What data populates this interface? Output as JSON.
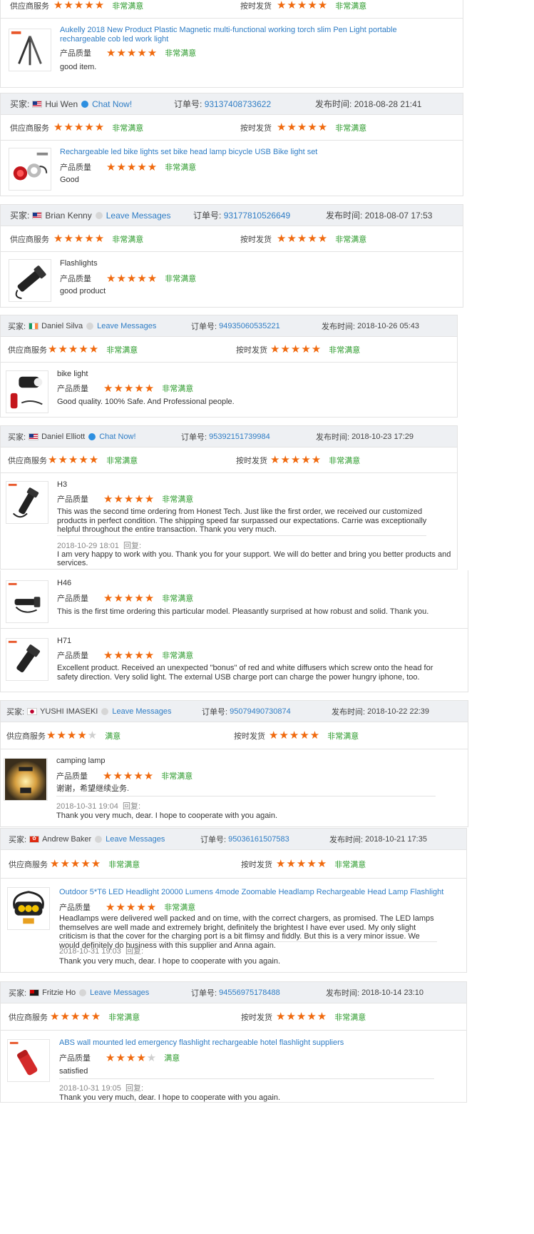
{
  "labels": {
    "supplier_service": "供应商服务",
    "on_time_delivery": "按时发货",
    "product_quality": "产品质量",
    "very_satisfied": "非常满意",
    "satisfied": "满意",
    "buyer": "买家:",
    "order_no": "订单号:",
    "published": "发布时间:",
    "reply": "回复:",
    "chat_now": "Chat Now!",
    "leave_messages": "Leave Messages"
  },
  "colors": {
    "star": "#f06a0f",
    "link": "#2f7dc5",
    "grade": "#2a9a2a",
    "header_bg": "#eef0f3"
  },
  "reviews": [
    {
      "supplier_stars": 5,
      "delivery_stars": 5,
      "product": {
        "title": "Aukelly 2018 New Product Plastic Magnetic multi-functional working torch slim Pen Light portable rechargeable cob led work light",
        "quality_stars": 5,
        "text": "good item.",
        "thumb": "pen-light-icon"
      }
    },
    {
      "buyer": "Hui Wen",
      "flag": "us-flag-icon",
      "contact": "Chat Now!",
      "order": "93137408733622",
      "time": "2018-08-28 21:41",
      "supplier_stars": 5,
      "delivery_stars": 5,
      "product": {
        "title": "Rechargeable led bike lights set bike head lamp bicycle USB Bike light set",
        "quality_stars": 5,
        "text": "Good",
        "thumb": "bike-light-icon"
      }
    },
    {
      "buyer": "Brian Kenny",
      "flag": "us-flag-icon",
      "contact": "Leave Messages",
      "order": "93177810526649",
      "time": "2018-08-07 17:53",
      "supplier_stars": 5,
      "delivery_stars": 5,
      "product": {
        "title": "Flashlights",
        "quality_stars": 5,
        "text": "good product",
        "thumb": "flashlight-icon"
      }
    },
    {
      "buyer": "Daniel Silva",
      "flag": "ireland-flag-icon",
      "contact": "Leave Messages",
      "order": "94935060535221",
      "time": "2018-10-26 05:43",
      "supplier_stars": 5,
      "delivery_stars": 5,
      "product": {
        "title": "bike light",
        "quality_stars": 5,
        "text": "Good quality. 100% Safe. And Professional people.",
        "thumb": "bike-light-icon"
      }
    },
    {
      "buyer": "Daniel Elliott",
      "flag": "us-flag-icon",
      "contact": "Chat Now!",
      "order": "95392151739984",
      "time": "2018-10-23 17:29",
      "supplier_stars": 5,
      "delivery_stars": 5,
      "products": [
        {
          "title": "H3",
          "quality_stars": 5,
          "text": "This was the second time ordering from Honest Tech. Just like the first order, we received our customized products in perfect condition. The shipping speed far surpassed our expectations. Carrie was exceptionally helpful throughout the entire transaction. Thank you very much.",
          "reply_date": "2018-10-29 18:01",
          "reply": "I am very happy to work with you. Thank you for your support. We will do better and bring you better products and services.",
          "thumb": "flashlight-icon"
        },
        {
          "title": "H46",
          "quality_stars": 5,
          "text": "This is the first time ordering this particular model. Pleasantly surprised at how robust and solid. Thank you.",
          "thumb": "flashlight-icon"
        },
        {
          "title": "H71",
          "quality_stars": 5,
          "text": "Excellent product. Received an unexpected \"bonus\" of red and white diffusers which screw onto the head for safety direction. Very solid light. The external USB charge port can charge the power hungry iphone, too.",
          "thumb": "flashlight-icon"
        }
      ]
    },
    {
      "buyer": "YUSHI IMASEKI",
      "flag": "japan-flag-icon",
      "contact": "Leave Messages",
      "order": "95079490730874",
      "time": "2018-10-22 22:39",
      "supplier_stars": 4,
      "supplier_grade": "满意",
      "delivery_stars": 5,
      "product": {
        "title": "camping lamp",
        "quality_stars": 5,
        "text": "谢谢，希望继续业务.",
        "reply_date": "2018-10-31 19:04",
        "reply": "Thank you very much, dear. I hope to cooperate with you again.",
        "thumb": "camping-lamp-icon"
      }
    },
    {
      "buyer": "Andrew Baker",
      "flag": "hongkong-flag-icon",
      "contact": "Leave Messages",
      "order": "95036161507583",
      "time": "2018-10-21 17:35",
      "supplier_stars": 5,
      "delivery_stars": 5,
      "product": {
        "title": "Outdoor 5*T6 LED Headlight 20000 Lumens 4mode Zoomable Headlamp Rechargeable Head Lamp Flashlight",
        "quality_stars": 5,
        "text": "Headlamps were delivered well packed and on time, with the correct chargers, as promised. The LED lamps themselves are well made and extremely bright, definitely the brightest I have ever used. My only slight criticism is that the cover for the charging port is a bit flimsy and fiddly. But this is a very minor issue. We would definitely do business with this supplier and Anna again.",
        "reply_date": "2018-10-31 19:03",
        "reply": "Thank you very much, dear. I hope to cooperate with you again.",
        "thumb": "headlamp-icon"
      }
    },
    {
      "buyer": "Fritzie Ho",
      "flag": "taiwan-flag-icon",
      "contact": "Leave Messages",
      "order": "94556975178488",
      "time": "2018-10-14 23:10",
      "supplier_stars": 5,
      "delivery_stars": 5,
      "product": {
        "title": "ABS wall mounted led emergency flashlight rechargeable hotel flashlight suppliers",
        "quality_stars": 4,
        "quality_grade": "满意",
        "text": "satisfied",
        "reply_date": "2018-10-31 19:05",
        "reply": "Thank you very much, dear. I hope to cooperate with you again.",
        "thumb": "emergency-flashlight-icon"
      }
    }
  ]
}
